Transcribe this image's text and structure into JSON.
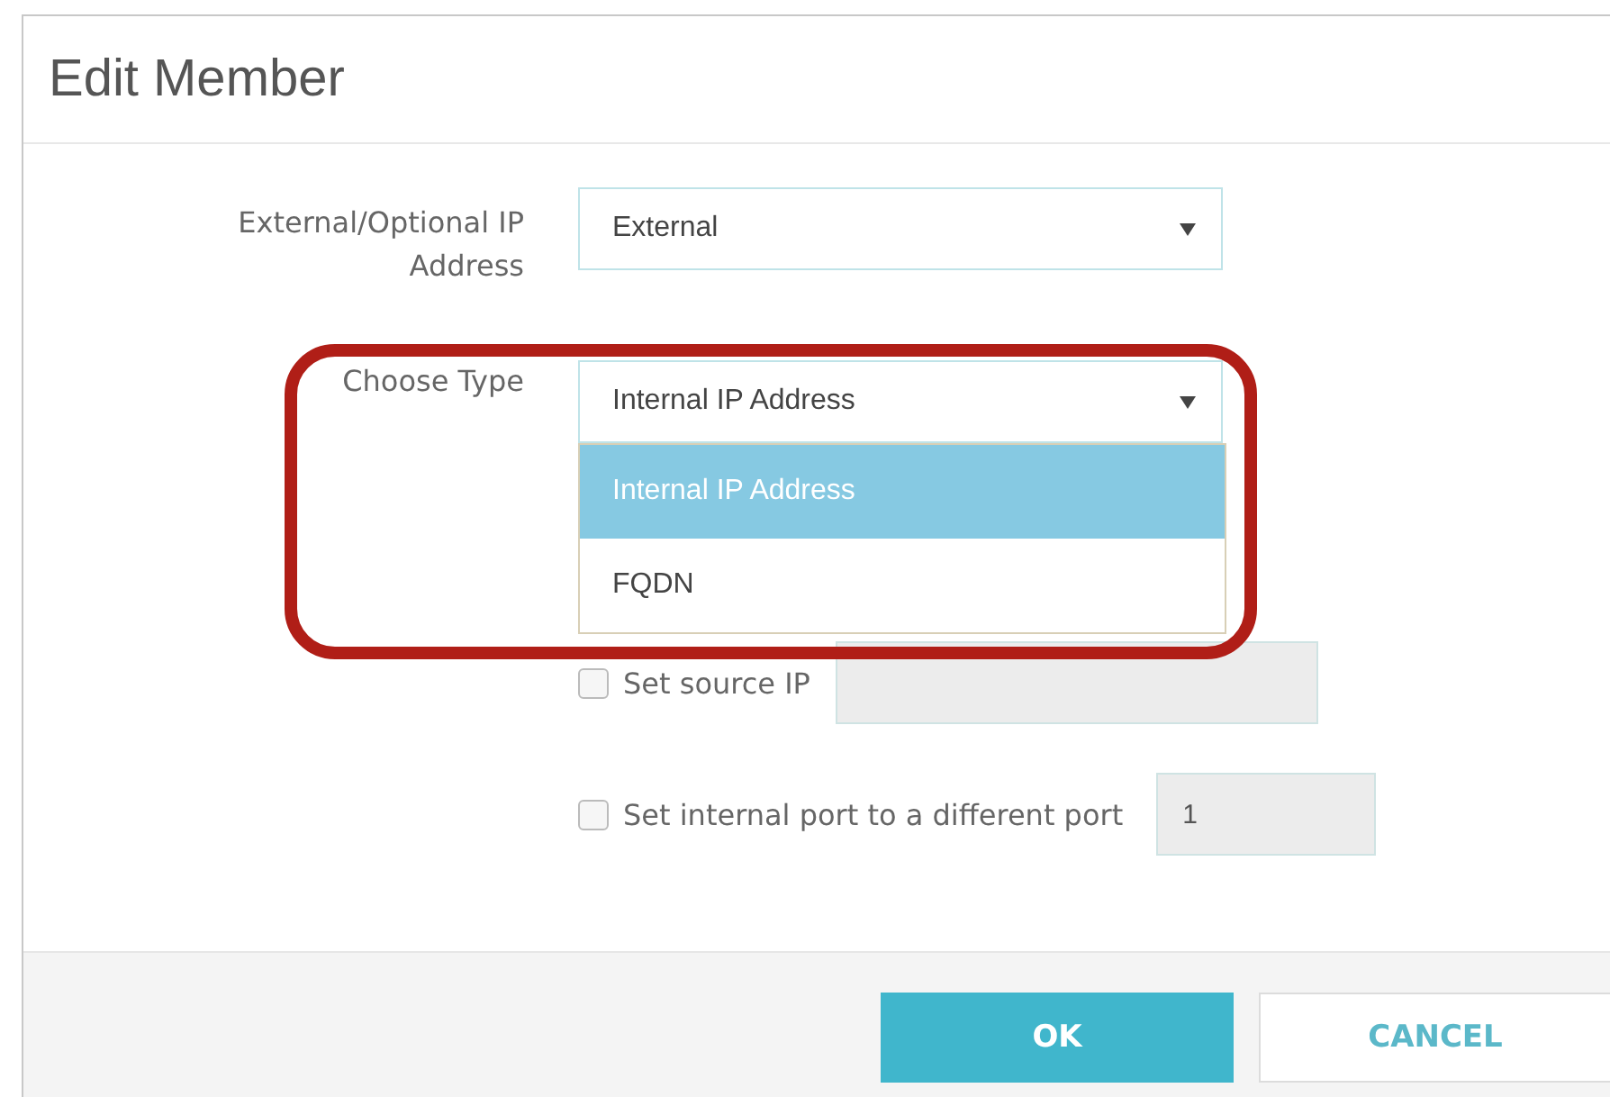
{
  "dialog": {
    "title": "Edit Member"
  },
  "address_select": {
    "label": "External/Optional IP Address",
    "value": "External"
  },
  "type_select": {
    "label": "Choose Type",
    "value": "Internal IP Address",
    "expanded": true,
    "options": [
      {
        "label": "Internal IP Address",
        "selected": true
      },
      {
        "label": "FQDN",
        "selected": false
      }
    ]
  },
  "options": [
    {
      "label": "Set source IP",
      "checked": false
    },
    {
      "label": "Set internal port to a different port",
      "checked": false,
      "value": "1"
    }
  ],
  "buttons": [
    {
      "label": "OK",
      "kind": "primary"
    },
    {
      "label": "CANCEL",
      "kind": "secondary"
    }
  ]
}
